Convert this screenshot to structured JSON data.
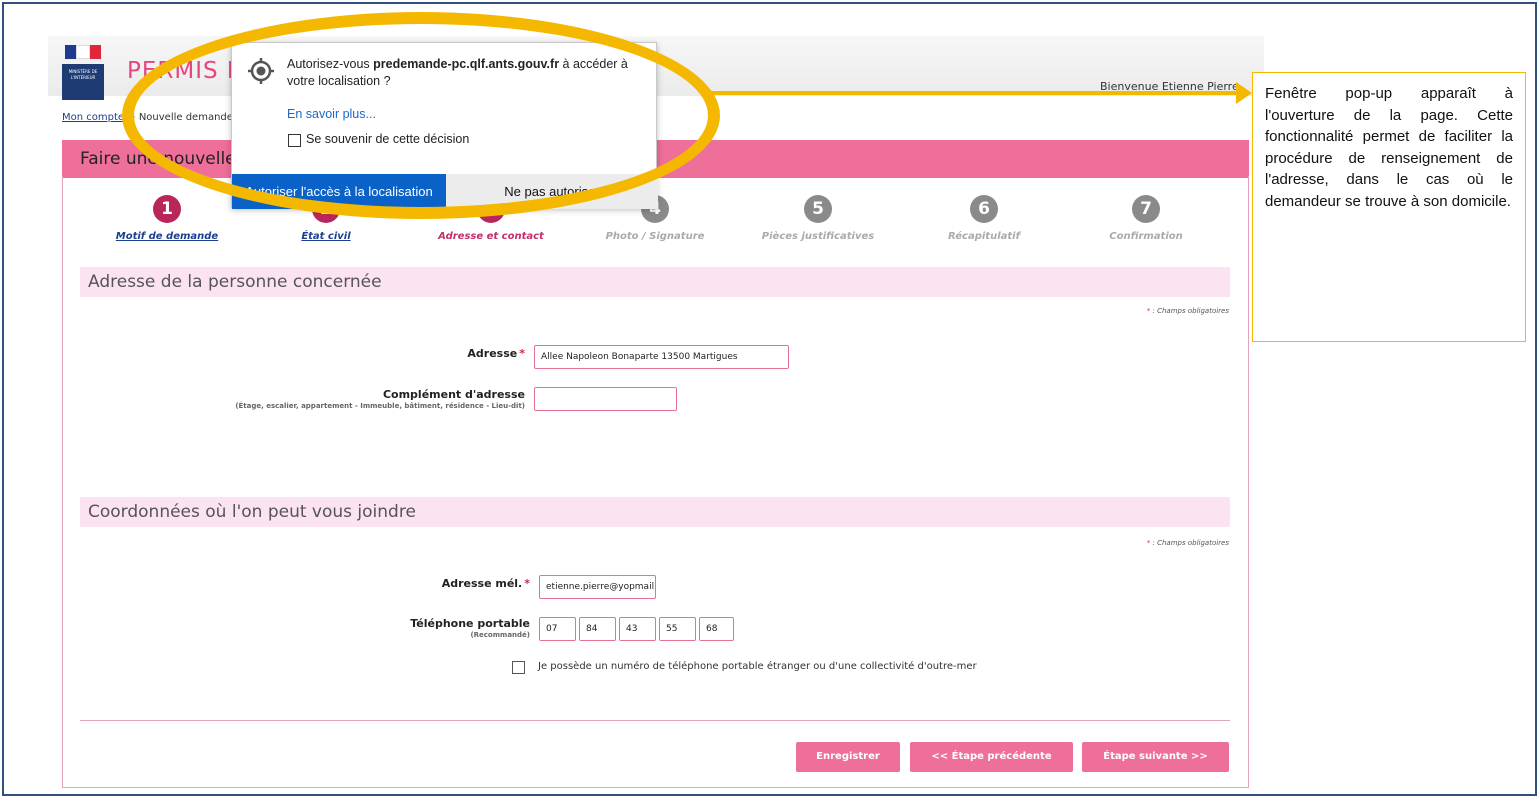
{
  "header": {
    "logo_text": "MINISTÈRE DE L'INTÉRIEUR",
    "app_title": "PERMIS DE CONDUIRE",
    "welcome": "Bienvenue Etienne Pierre"
  },
  "breadcrumb": {
    "link": "Mon compte",
    "sep": ">",
    "current": "Nouvelle demande"
  },
  "page_title": "Faire une nouvelle demande",
  "steps": [
    {
      "num": "1",
      "label": "Motif de demande"
    },
    {
      "num": "2",
      "label": "État civil"
    },
    {
      "num": "3",
      "label": "Adresse et contact"
    },
    {
      "num": "4",
      "label": "Photo / Signature"
    },
    {
      "num": "5",
      "label": "Pièces justificatives"
    },
    {
      "num": "6",
      "label": "Récapitulatif"
    },
    {
      "num": "7",
      "label": "Confirmation"
    }
  ],
  "section_address": {
    "title": "Adresse de la personne concernée",
    "required_note": ": Champs obligatoires",
    "address_label": "Adresse",
    "address_value": "Allee Napoleon Bonaparte 13500 Martigues",
    "complement_label": "Complément d'adresse",
    "complement_hint": "(Étage, escalier, appartement - Immeuble, bâtiment, résidence - Lieu-dit)",
    "complement_value": ""
  },
  "section_contact": {
    "title": "Coordonnées où l'on peut vous joindre",
    "required_note": ": Champs obligatoires",
    "email_label": "Adresse mél.",
    "email_value": "etienne.pierre@yopmail.",
    "phone_label": "Téléphone portable",
    "phone_hint": "(Recommandé)",
    "phone_parts": [
      "07",
      "84",
      "43",
      "55",
      "68"
    ],
    "foreign_phone_label": "Je possède un numéro de téléphone portable étranger ou d'une collectivité d'outre-mer"
  },
  "buttons": {
    "save": "Enregistrer",
    "previous": "<< Étape précédente",
    "next": "Étape suivante >>"
  },
  "popup": {
    "message_prefix": "Autorisez-vous ",
    "domain": "predemande-pc.qlf.ants.gouv.fr",
    "message_suffix": " à accéder à votre localisation ?",
    "learn_more": "En savoir plus...",
    "remember": "Se souvenir de cette décision",
    "allow": "Autoriser l'accès à la localisation",
    "deny": "Ne pas autoriser"
  },
  "annotation": {
    "text": "Fenêtre pop-up apparaît à l'ouverture de la page. Cette fonctionnalité permet de faciliter la procédure de renseignement de l'adresse, dans le cas où le demandeur se trouve à son domicile."
  },
  "colors": {
    "brand_pink": "#ee6f9a",
    "step_active": "#b8265a",
    "annotation_yellow": "#f5b800",
    "popup_blue": "#0a62c9"
  }
}
